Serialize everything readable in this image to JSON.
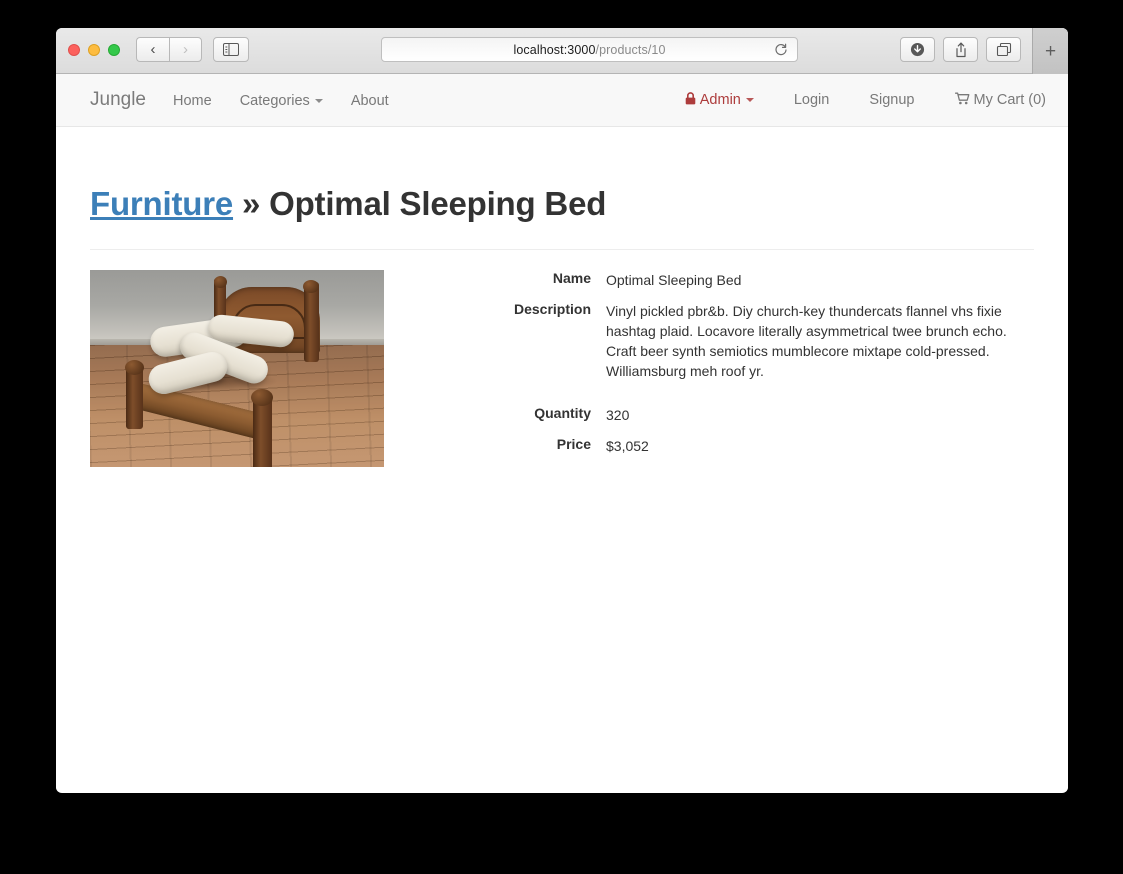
{
  "browser": {
    "url_host": "localhost:3000",
    "url_path": "/products/10",
    "traffic_lights": [
      "close",
      "minimize",
      "maximize"
    ],
    "buttons": {
      "back": "back-arrow",
      "forward": "forward-arrow",
      "sidebar": "sidebar-toggle",
      "reload": "reload-icon",
      "download": "download-icon",
      "share": "share-icon",
      "tabs": "tab-overview-icon",
      "new_tab": "+"
    }
  },
  "site_nav": {
    "brand": "Jungle",
    "left_links": [
      {
        "label": "Home",
        "caret": false
      },
      {
        "label": "Categories",
        "caret": true
      },
      {
        "label": "About",
        "caret": false
      }
    ],
    "right_links": [
      {
        "label": "Admin",
        "caret": true,
        "icon": "lock-icon",
        "color": "#ad3c3c"
      },
      {
        "label": "Login",
        "caret": false,
        "icon": null
      },
      {
        "label": "Signup",
        "caret": false,
        "icon": null
      },
      {
        "label": "My Cart (0)",
        "caret": false,
        "icon": "shopping-cart-icon"
      }
    ]
  },
  "page": {
    "category": "Furniture",
    "separator": "»",
    "product_name": "Optimal Sleeping Bed",
    "image_alt": "Wooden bed frame with a zigzag mattress on a hardwood floor"
  },
  "details": {
    "rows": [
      {
        "label": "Name",
        "value": "Optimal Sleeping Bed"
      },
      {
        "label": "Description",
        "value": "Vinyl pickled pbr&b. Diy church-key thundercats flannel vhs fixie hashtag plaid. Locavore literally asymmetrical twee brunch echo. Craft beer synth semiotics mumblecore mixtape cold-pressed. Williamsburg meh roof yr."
      },
      {
        "label": "Quantity",
        "value": "320"
      },
      {
        "label": "Price",
        "value": "$3,052"
      }
    ]
  },
  "colors": {
    "link_blue": "#3c7fb8",
    "admin_red": "#ad3c3c",
    "nav_text": "#797979",
    "navbar_bg": "#f8f8f8",
    "page_bg": "#ffffff",
    "desktop_bg": "#000000"
  }
}
